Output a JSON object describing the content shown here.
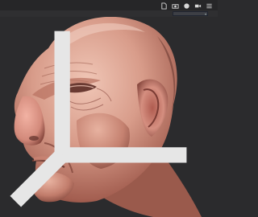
{
  "window": {
    "dropdown_value": "",
    "toolbar_icons": [
      "file-icon",
      "camera-icon",
      "record-icon",
      "video-icon",
      "menu-icon"
    ]
  },
  "viewport": {
    "model": "sculpted-head-icon",
    "gizmo": "axis-gizmo-icon",
    "colors": {
      "background": "#2b2b2d",
      "skin_base": "#d89c8a",
      "skin_shadow": "#6a3a32",
      "skin_highlight": "#f0c6b6"
    }
  }
}
